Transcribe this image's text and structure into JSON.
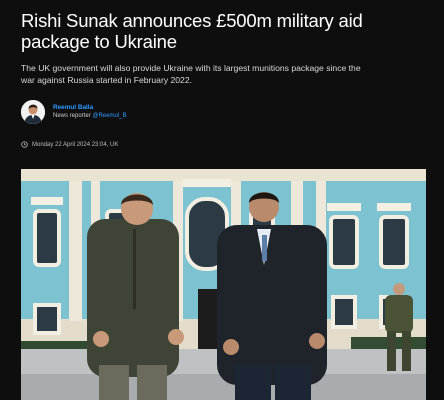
{
  "article": {
    "headline": "Rishi Sunak announces £500m military aid package to Ukraine",
    "standfirst": "The UK government will also provide Ukraine with its largest munitions package since the war against Russia started in February 2022.",
    "author": {
      "name": "Reemul Balla",
      "role": "News reporter ",
      "handle": "@Reemul_B",
      "avatar_icon": "user-avatar"
    },
    "timestamp": "Monday 22 April 2024 23:04, UK",
    "timestamp_icon": "clock-icon",
    "hero_image": {
      "subject": "photo-two-men-walking-palace"
    }
  },
  "colors": {
    "background": "#0e0e0e",
    "headline": "#ffffff",
    "link": "#2e9bff",
    "meta": "#bdbdbd"
  }
}
